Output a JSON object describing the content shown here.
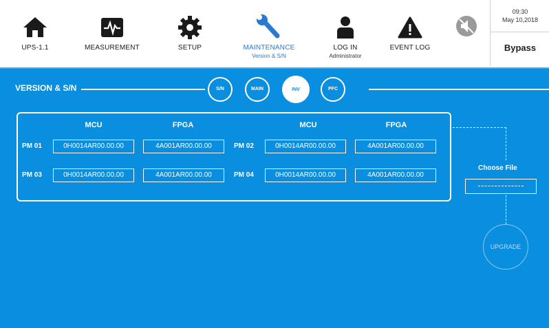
{
  "nav": {
    "items": [
      {
        "label": "UPS-1.1",
        "sub": "",
        "icon": "home-icon"
      },
      {
        "label": "MEASUREMENT",
        "sub": "",
        "icon": "waveform-icon"
      },
      {
        "label": "SETUP",
        "sub": "",
        "icon": "gear-icon"
      },
      {
        "label": "MAINTENANCE",
        "sub": "Version & S/N",
        "icon": "wrench-icon"
      },
      {
        "label": "LOG IN",
        "sub": "Administrator",
        "icon": "user-icon"
      },
      {
        "label": "EVENT LOG",
        "sub": "",
        "icon": "warning-icon"
      }
    ],
    "mute_icon": "mute-icon"
  },
  "status": {
    "time": "09:30",
    "date": "May 10,2018",
    "mode": "Bypass"
  },
  "section": {
    "title": "VERSION & S/N"
  },
  "tabs": [
    {
      "label": "S/N"
    },
    {
      "label": "MAIN"
    },
    {
      "label": "INV"
    },
    {
      "label": "PFC"
    }
  ],
  "columns": {
    "mcu1": "MCU",
    "fpga1": "FPGA",
    "mcu2": "MCU",
    "fpga2": "FPGA"
  },
  "modules": [
    {
      "name": "PM 01",
      "mcu": "0H0014AR00.00.00",
      "fpga": "4A001AR00.00.00"
    },
    {
      "name": "PM 02",
      "mcu": "0H0014AR00.00.00",
      "fpga": "4A001AR00.00.00"
    },
    {
      "name": "PM 03",
      "mcu": "0H0014AR00.00.00",
      "fpga": "4A001AR00.00.00"
    },
    {
      "name": "PM 04",
      "mcu": "0H0014AR00.00.00",
      "fpga": "4A001AR00.00.00"
    }
  ],
  "upgrade": {
    "choose_label": "Choose File",
    "button": "UPGRADE"
  },
  "colors": {
    "background": "#0a8fe0",
    "accent": "#2a7bd0",
    "active_tab": "#ffffff"
  }
}
